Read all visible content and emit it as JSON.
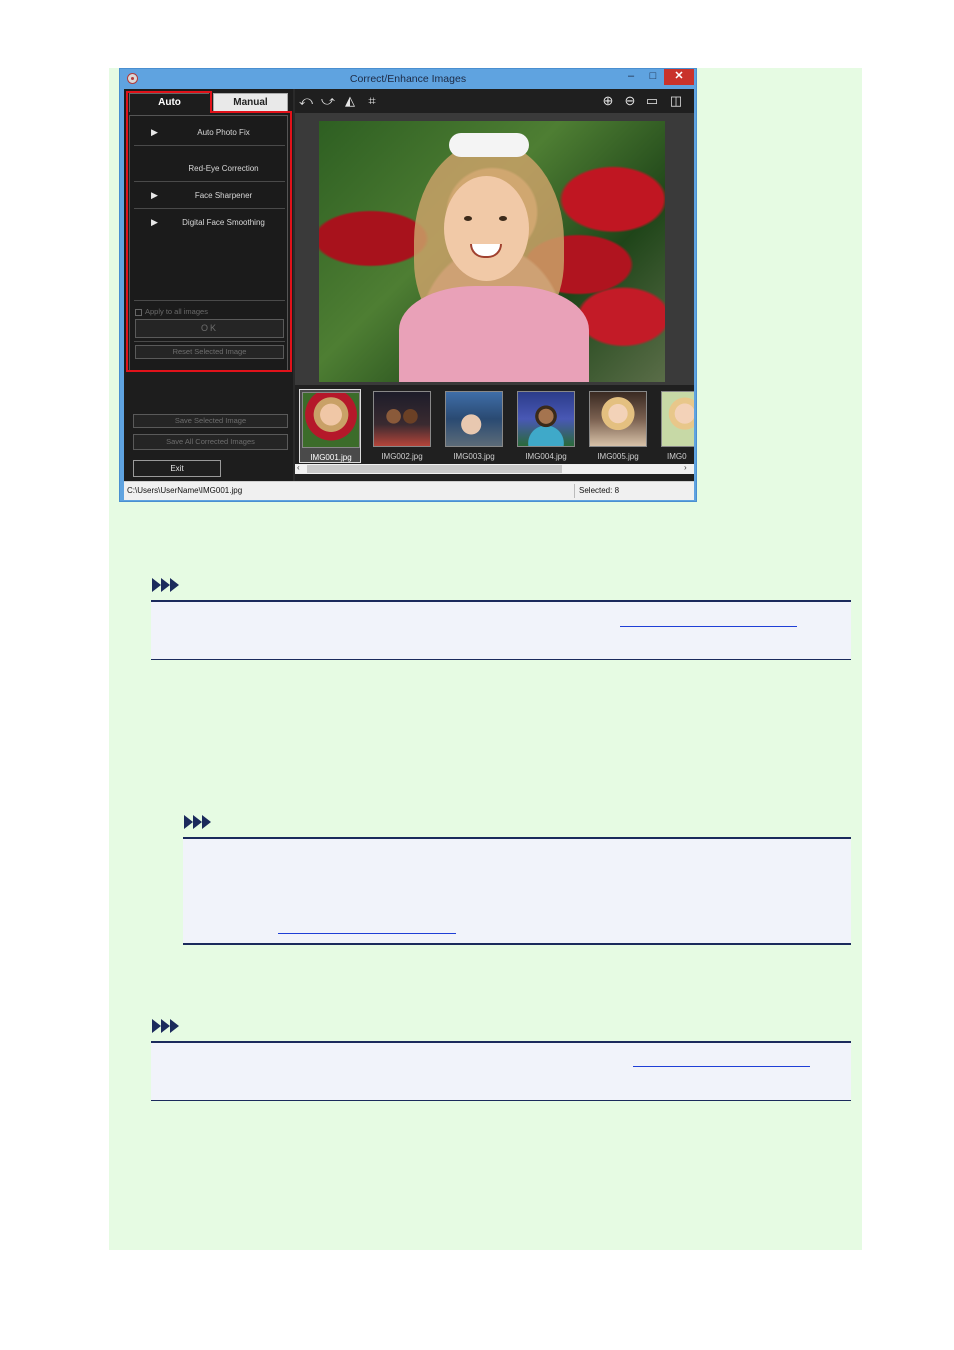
{
  "window": {
    "title": "Correct/Enhance Images",
    "controls": {
      "minimize": "–",
      "maximize": "□",
      "close": "✕"
    }
  },
  "tabs": {
    "auto": "Auto",
    "manual": "Manual"
  },
  "auto_panel": {
    "items": [
      {
        "label": "Auto Photo Fix",
        "expandable": true
      },
      {
        "label": "Red-Eye Correction",
        "expandable": false
      },
      {
        "label": "Face Sharpener",
        "expandable": true
      },
      {
        "label": "Digital Face Smoothing",
        "expandable": true
      }
    ],
    "apply_all_label": "Apply to all images",
    "ok_label": "OK",
    "reset_label": "Reset Selected Image"
  },
  "save_selected_label": "Save Selected Image",
  "save_all_label": "Save All Corrected Images",
  "exit_label": "Exit",
  "toolbar_icons": [
    "rotate-left-icon",
    "rotate-right-icon",
    "flip-icon",
    "crop-icon",
    "zoom-in-icon",
    "zoom-out-icon",
    "full-screen-icon",
    "compare-icon"
  ],
  "thumbnails": [
    "IMG001.jpg",
    "IMG002.jpg",
    "IMG003.jpg",
    "IMG004.jpg",
    "IMG005.jpg",
    "IMG0"
  ],
  "selected_thumbnail": "IMG001.jpg",
  "status": {
    "path": "C:\\Users\\UserName\\IMG001.jpg",
    "selected": "Selected: 8"
  },
  "colors": {
    "highlight": "#e1121a",
    "page_bg": "#e6fbe3",
    "note_rule": "#1b2a5c",
    "link": "#1f3fd6"
  }
}
